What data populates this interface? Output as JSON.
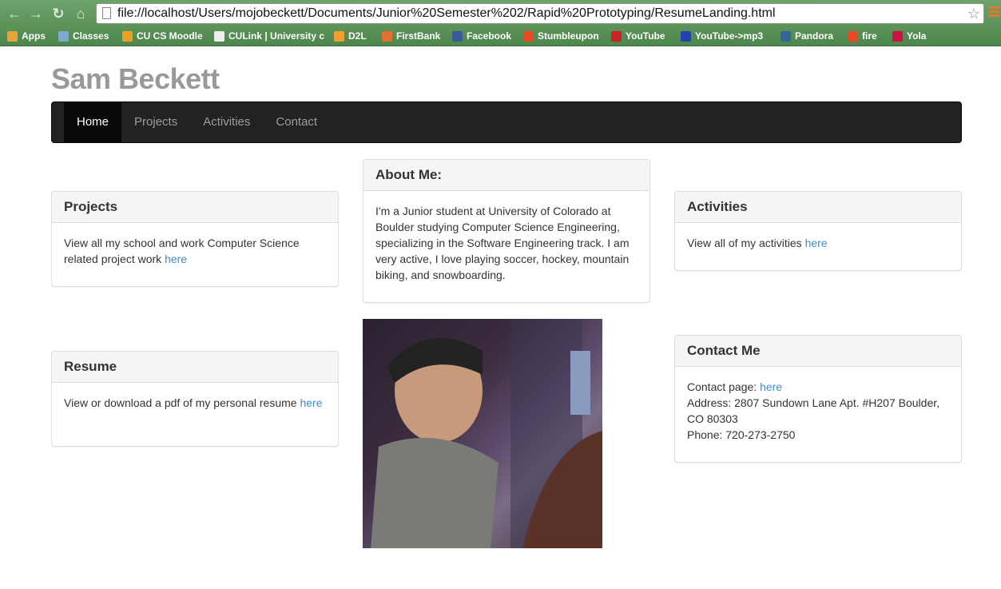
{
  "browser": {
    "url": "file://localhost/Users/mojobeckett/Documents/Junior%20Semester%202/Rapid%20Prototyping/ResumeLanding.html",
    "bookmarks": [
      {
        "label": "Apps",
        "color": "#e8a33a"
      },
      {
        "label": "Classes",
        "color": "#7fa7d6"
      },
      {
        "label": "CU CS Moodle",
        "color": "#f0a020"
      },
      {
        "label": "CULink | University c",
        "color": "#eeeeee"
      },
      {
        "label": "D2L",
        "color": "#f0a030"
      },
      {
        "label": "FirstBank",
        "color": "#e07030"
      },
      {
        "label": "Facebook",
        "color": "#3b5998"
      },
      {
        "label": "Stumbleupon",
        "color": "#eb4924"
      },
      {
        "label": "YouTube",
        "color": "#cc2222"
      },
      {
        "label": "YouTube->mp3",
        "color": "#2244aa"
      },
      {
        "label": "Pandora",
        "color": "#336699"
      },
      {
        "label": "fire",
        "color": "#eb4924"
      },
      {
        "label": "Yola",
        "color": "#cc1144"
      }
    ]
  },
  "site": {
    "title": "Sam Beckett",
    "nav": [
      "Home",
      "Projects",
      "Activities",
      "Contact"
    ],
    "projects": {
      "title": "Projects",
      "text": "View all my school and work Computer Science related project work ",
      "link": "here"
    },
    "about": {
      "title": "About Me:",
      "text": "I'm a Junior student at University of Colorado at Boulder studying Computer Science Engineering, specializing in the Software Engineering track. I am very active, I love playing soccer, hockey, mountain biking, and snowboarding."
    },
    "activities": {
      "title": "Activities",
      "text": "View all of my activities ",
      "link": "here"
    },
    "resume": {
      "title": "Resume",
      "text": "View or download a pdf of my personal resume ",
      "link": "here"
    },
    "contact": {
      "title": "Contact Me",
      "page_label": "Contact page: ",
      "link": "here",
      "address": "Address: 2807 Sundown Lane Apt. #H207 Boulder, CO 80303",
      "phone": "Phone: 720-273-2750"
    }
  }
}
